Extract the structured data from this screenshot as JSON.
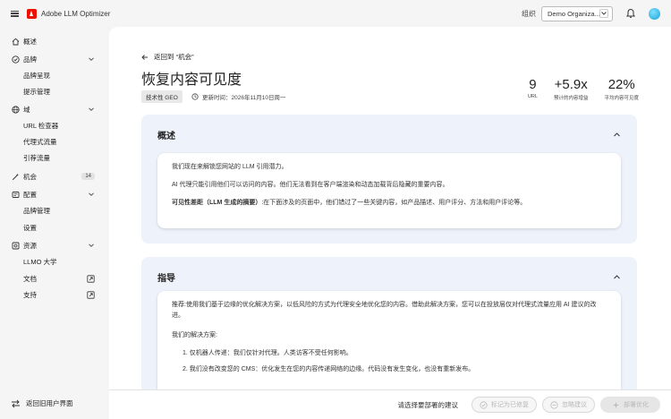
{
  "app": {
    "title": "Adobe LLM Optimizer"
  },
  "topbar": {
    "org_label": "组织",
    "org_value": "Demo Organiza..."
  },
  "sidebar": {
    "overview": "概述",
    "brand": "品牌",
    "brand_sub": [
      "品牌呈现",
      "提示管理"
    ],
    "domain": "域",
    "domain_sub": [
      "URL 检查器",
      "代理式流量",
      "引荐流量"
    ],
    "opportunities": "机会",
    "opportunities_count": "14",
    "config": "配置",
    "config_sub": [
      "品牌管理",
      "设置"
    ],
    "resources": "资源",
    "resources_sub": [
      "LLMO 大学",
      "文档",
      "支持"
    ],
    "back_old": "返回旧用户界面"
  },
  "page": {
    "back_label": "返回到 “机会”",
    "title": "恢复内容可见度",
    "tag": "技术性 GEO",
    "updated": "更新时间：2026年11月10日周一"
  },
  "stats": [
    {
      "value": "9",
      "label": "URL"
    },
    {
      "value": "+5.9x",
      "label": "预计的内容增益"
    },
    {
      "value": "22%",
      "label": "平均内容可见度"
    }
  ],
  "overview_panel": {
    "heading": "概述",
    "p1": "我们现在来解锁您网站的 LLM 引用潜力。",
    "p2": "AI 代理只能引用他们可以访问的内容。他们无法看到在客户端渲染和动态加载背后隐藏的重要内容。",
    "p3_bold": "可见性差距（LLM 生成的摘要）",
    "p3_rest": ":在下面涉及的页面中，他们错过了一些关键内容，如产品描述、用户评分、方法和用户评论等。"
  },
  "guidance_panel": {
    "heading": "指导",
    "p1": "推荐:使用我们基于边缘的优化解决方案，以低风险的方式为代理安全地优化您的内容。借助此解决方案，您可以在投放层仅对代理式流量应用 AI 建议的改进。",
    "solution_heading": "我们的解决方案:",
    "items": [
      "1. 仅机器人传递：我们仅针对代理。人类访客不受任何影响。",
      "2. 我们没有改变您的 CMS：优化发生在您的内容传递网络的边缘。代码没有发生变化，也没有重新发布。"
    ]
  },
  "bottombar": {
    "hint": "请选择要部署的建议",
    "btn_edge": "标记为已修复",
    "btn_skip": "忽略建议",
    "btn_deploy": "部署优化"
  }
}
